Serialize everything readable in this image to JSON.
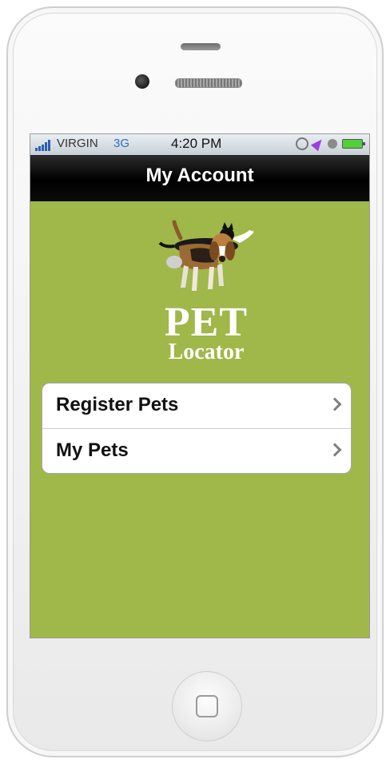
{
  "status_bar": {
    "carrier": "VIRGIN",
    "network": "3G",
    "time": "4:20 PM",
    "icons": [
      "signal-bars-icon",
      "rotation-lock-icon",
      "location-icon",
      "alarm-icon",
      "battery-icon"
    ]
  },
  "nav": {
    "title": "My Account"
  },
  "logo": {
    "line1": "PET",
    "line2": "Locator"
  },
  "menu": {
    "items": [
      {
        "label": "Register Pets"
      },
      {
        "label": "My Pets"
      }
    ]
  },
  "colors": {
    "screen_bg": "#a0b74a",
    "navbar": "#000000",
    "menu_bg": "#ffffff"
  }
}
